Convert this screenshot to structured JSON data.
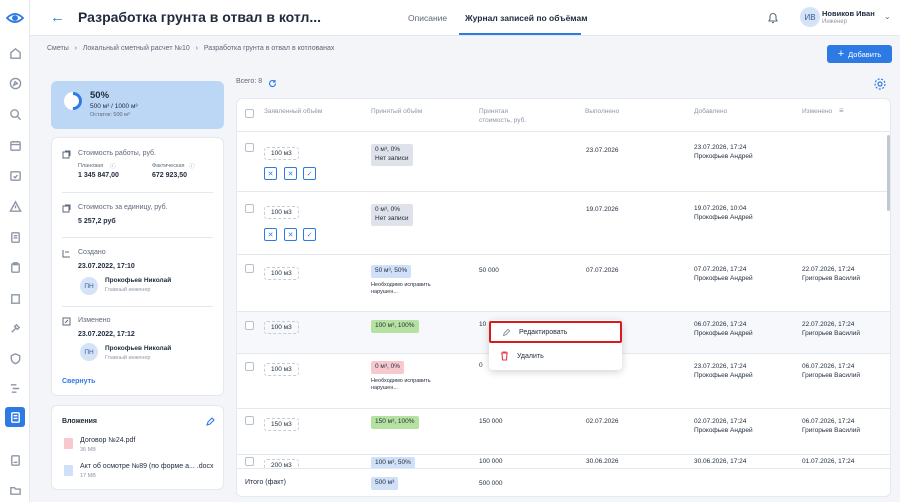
{
  "header": {
    "title": "Разработка грунта в отвал в котл...",
    "tabs": [
      {
        "label": "Описание",
        "active": false
      },
      {
        "label": "Журнал записей по объёмам",
        "active": true
      }
    ],
    "user": {
      "initials": "ИВ",
      "name": "Новиков Иван",
      "role": "Инженер"
    }
  },
  "breadcrumbs": [
    "Сметы",
    "Локальный сметный расчет №10",
    "Разработка грунта в отвал в котлованах"
  ],
  "add_button": "Добавить",
  "progress": {
    "percent": "50%",
    "volume": "500 м³ / 1000 м³",
    "remaining": "Остаток: 500 м³",
    "fraction": 0.5
  },
  "info": {
    "cost_label": "Стоимость работы, руб.",
    "planned_label": "Плановая",
    "planned_value": "1 345 847,00",
    "actual_label": "Фактическая",
    "actual_value": "672 923,50",
    "unit_cost_label": "Стоимость за единицу, руб.",
    "unit_cost_value": "5 257,2 руб",
    "created_label": "Создано",
    "created_date": "23.07.2022, 17:10",
    "created_by": {
      "initials": "ПН",
      "name": "Прокофьев Николай",
      "role": "Главный инженер"
    },
    "changed_label": "Изменено",
    "changed_date": "23.07.2022, 17:12",
    "changed_by": {
      "initials": "ПН",
      "name": "Прокофьев Николай",
      "role": "Главный инженер"
    },
    "collapse": "Свернуть"
  },
  "attachments": {
    "title": "Вложения",
    "files": [
      {
        "name": "Договор №24.pdf",
        "size": "36 MB",
        "type": "pdf"
      },
      {
        "name": "Акт об осмотре №89 (по форме а... .docx",
        "size": "17 MB",
        "type": "docx"
      }
    ]
  },
  "table": {
    "total": "Всего: 8",
    "headers": [
      "Заявленный объём",
      "Принятый объём",
      "Принятая стоимость, руб.",
      "Выполнено",
      "Добавлено",
      "Изменено"
    ],
    "rows": [
      {
        "declared": "100 м3",
        "accepted": "0 м³, 0%\nНет записи",
        "accepted_color": "gray",
        "note": "",
        "cost": "",
        "done": "23.07.2026",
        "added": "23.07.2026, 17:24\nПрокофьев Андрей",
        "changed": "",
        "actions": true
      },
      {
        "declared": "100 м3",
        "accepted": "0 м³, 0%\nНет записи",
        "accepted_color": "gray",
        "note": "",
        "cost": "",
        "done": "19.07.2026",
        "added": "19.07.2026, 10:04\nПрокофьев Андрей",
        "changed": "",
        "actions": true
      },
      {
        "declared": "100 м3",
        "accepted": "50 м³, 50%",
        "accepted_color": "blue",
        "note": "Необходимо исправить\nнарушен...",
        "cost": "50 000",
        "done": "07.07.2026",
        "added": "07.07.2026, 17:24\nПрокофьев Андрей",
        "changed": "22.07.2026, 17:24\nГригорьев Василий",
        "actions": false
      },
      {
        "declared": "100 м3",
        "accepted": "100 м³, 100%",
        "accepted_color": "green",
        "note": "",
        "cost": "10",
        "done": "",
        "added": "06.07.2026, 17:24\nПрокофьев Андрей",
        "changed": "22.07.2026, 17:24\nГригорьев Василий",
        "actions": false
      },
      {
        "declared": "100 м3",
        "accepted": "0 м³, 0%",
        "accepted_color": "pink",
        "note": "Необходимо исправить\nнарушен...",
        "cost": "0",
        "done": "",
        "added": "23.07.2026, 17:24\nПрокофьев Андрей",
        "changed": "06.07.2026, 17:24\nГригорьев Василий",
        "actions": false
      },
      {
        "declared": "150 м3",
        "accepted": "150 м³, 100%",
        "accepted_color": "green",
        "note": "",
        "cost": "150 000",
        "done": "02.07.2026",
        "added": "02.07.2026, 17:24\nПрокофьев Андрей",
        "changed": "06.07.2026, 17:24\nГригорьев Василий",
        "actions": false
      },
      {
        "declared": "200 м3",
        "accepted": "100 м³, 50%",
        "accepted_color": "blue",
        "note": "",
        "cost": "100 000",
        "done": "30.06.2026",
        "added": "30.06.2026, 17:24",
        "changed": "01.07.2026, 17:24",
        "actions": false
      }
    ],
    "footer": {
      "label": "Итого (факт)",
      "accepted": "500 м³",
      "cost": "500 000"
    }
  },
  "context_menu": {
    "edit": "Редактировать",
    "delete": "Удалить"
  },
  "colors": {
    "accent": "#2d7ae5",
    "progress_bg": "#bcd6f5",
    "highlight": "#d81a1a"
  }
}
